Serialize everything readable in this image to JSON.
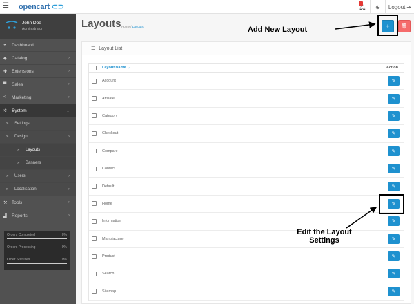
{
  "header": {
    "logo_text": "opencart",
    "logo_cart": "🛒",
    "logout_label": "Logout"
  },
  "sidebar": {
    "user_name": "John Doe",
    "user_role": "Administrator",
    "items": [
      {
        "label": "Dashboard",
        "icon": "dashboard-icon"
      },
      {
        "label": "Catalog",
        "icon": "tag-icon"
      },
      {
        "label": "Extensions",
        "icon": "puzzle-icon"
      },
      {
        "label": "Sales",
        "icon": "cart-icon"
      },
      {
        "label": "Marketing",
        "icon": "share-icon"
      },
      {
        "label": "System",
        "icon": "cog-icon"
      },
      {
        "label": "Settings"
      },
      {
        "label": "Design"
      },
      {
        "label": "Layouts"
      },
      {
        "label": "Banners"
      },
      {
        "label": "Users"
      },
      {
        "label": "Localisation"
      },
      {
        "label": "Tools",
        "icon": "wrench-icon"
      },
      {
        "label": "Reports",
        "icon": "bar-chart-icon"
      }
    ],
    "stats": [
      {
        "label": "Orders Completed",
        "value": "0%"
      },
      {
        "label": "Orders Processing",
        "value": "0%"
      },
      {
        "label": "Other Statuses",
        "value": "0%"
      }
    ]
  },
  "main": {
    "title": "Layouts",
    "breadcrumb": {
      "home": "Home",
      "sep": "/",
      "current": "Layouts"
    },
    "panel_title": "Layout List",
    "table": {
      "col_name": "Layout Name",
      "col_action": "Action",
      "rows": [
        "Account",
        "Affiliate",
        "Category",
        "Checkout",
        "Compare",
        "Contact",
        "Default",
        "Home",
        "Information",
        "Manufacturer",
        "Product",
        "Search",
        "Sitemap"
      ]
    }
  },
  "annotations": {
    "add_new": "Add New Layout",
    "edit_line1": "Edit the Layout",
    "edit_line2": "Settings"
  },
  "colors": {
    "primary": "#1e91cf",
    "danger": "#f56b6b",
    "sidebar": "#515151"
  }
}
